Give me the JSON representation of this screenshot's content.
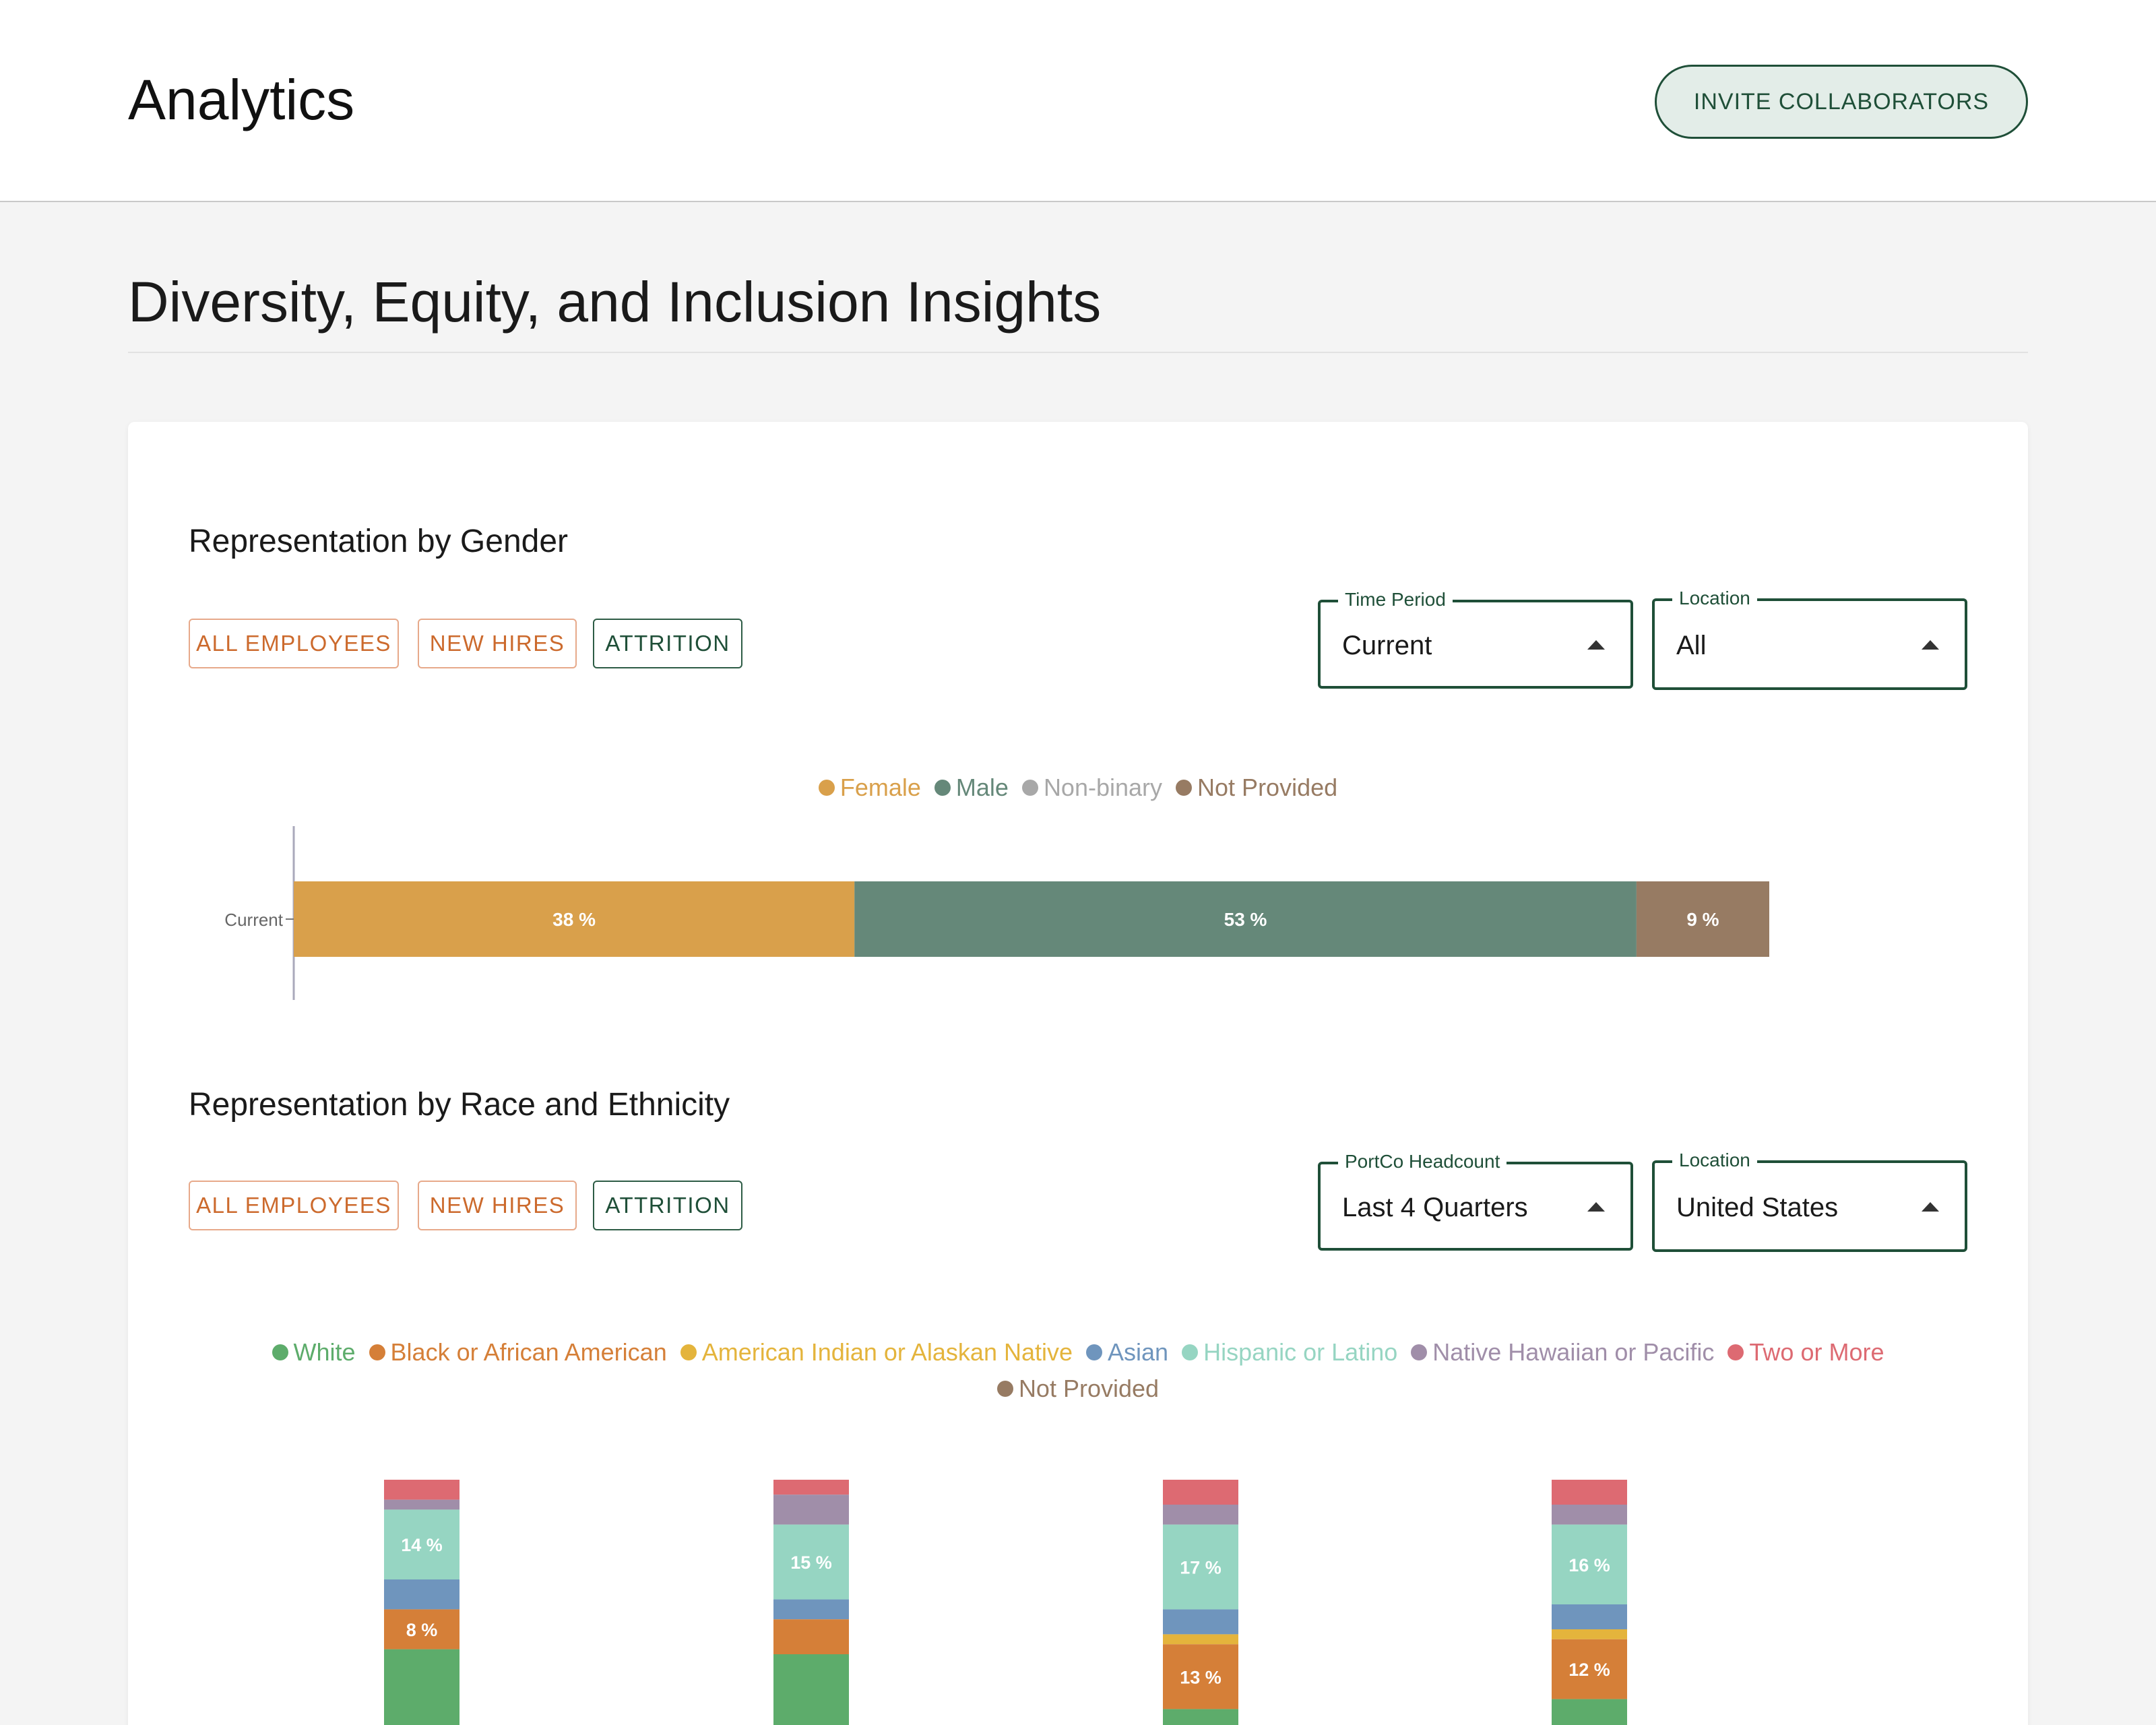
{
  "header": {
    "title": "Analytics",
    "invite_label": "INVITE COLLABORATORS"
  },
  "section": {
    "title": "Diversity, Equity, and Inclusion Insights"
  },
  "tabs": {
    "all_employees": "ALL EMPLOYEES",
    "new_hires": "NEW HIRES",
    "attrition": "ATTRITION"
  },
  "gender": {
    "title": "Representation by Gender",
    "time_period": {
      "label": "Time Period",
      "value": "Current"
    },
    "location": {
      "label": "Location",
      "value": "All"
    }
  },
  "race": {
    "title": "Representation by Race and Ethnicity",
    "headcount": {
      "label": "PortCo Headcount",
      "value": "Last 4 Quarters"
    },
    "location": {
      "label": "Location",
      "value": "United States"
    }
  },
  "colors": {
    "accent_green": "#1f4f38",
    "tab_orange": "#cc6a2d"
  },
  "chart_data": [
    {
      "type": "bar",
      "orientation": "horizontal",
      "stacked": true,
      "categories": [
        "Current"
      ],
      "series": [
        {
          "name": "Female",
          "color": "#d9a04b",
          "values": [
            38
          ],
          "label": "38 %"
        },
        {
          "name": "Male",
          "color": "#658879",
          "values": [
            53
          ],
          "label": "53 %"
        },
        {
          "name": "Non-binary",
          "color": "#a8a8a8",
          "values": [
            0
          ],
          "label": ""
        },
        {
          "name": "Not Provided",
          "color": "#977b63",
          "values": [
            9
          ],
          "label": "9 %"
        }
      ],
      "xlim": [
        0,
        100
      ],
      "legend": "top-center"
    },
    {
      "type": "bar",
      "orientation": "vertical",
      "stacked": true,
      "n_bars": 4,
      "series": [
        {
          "name": "White",
          "color": "#5dac6b",
          "values": [
            null,
            null,
            null,
            null
          ]
        },
        {
          "name": "Black or African American",
          "color": "#d57f38",
          "values": [
            8,
            7,
            13,
            12
          ],
          "labels": [
            "8 %",
            "",
            "13 %",
            "12 %"
          ]
        },
        {
          "name": "American Indian or Alaskan Native",
          "color": "#e4b43c",
          "values": [
            0,
            0,
            2,
            2
          ]
        },
        {
          "name": "Asian",
          "color": "#6f95bd",
          "values": [
            6,
            4,
            5,
            5
          ]
        },
        {
          "name": "Hispanic or Latino",
          "color": "#96d5c2",
          "values": [
            14,
            15,
            17,
            16
          ],
          "labels": [
            "14 %",
            "15 %",
            "17 %",
            "16 %"
          ]
        },
        {
          "name": "Native Hawaiian or Pacific",
          "color": "#a08ea9",
          "values": [
            2,
            6,
            4,
            4
          ]
        },
        {
          "name": "Two or More",
          "color": "#dd6a72",
          "values": [
            4,
            3,
            5,
            5
          ]
        },
        {
          "name": "Not Provided",
          "color": "#977b63",
          "values": [
            0,
            0,
            0,
            0
          ]
        }
      ],
      "legend": "top-center"
    }
  ]
}
